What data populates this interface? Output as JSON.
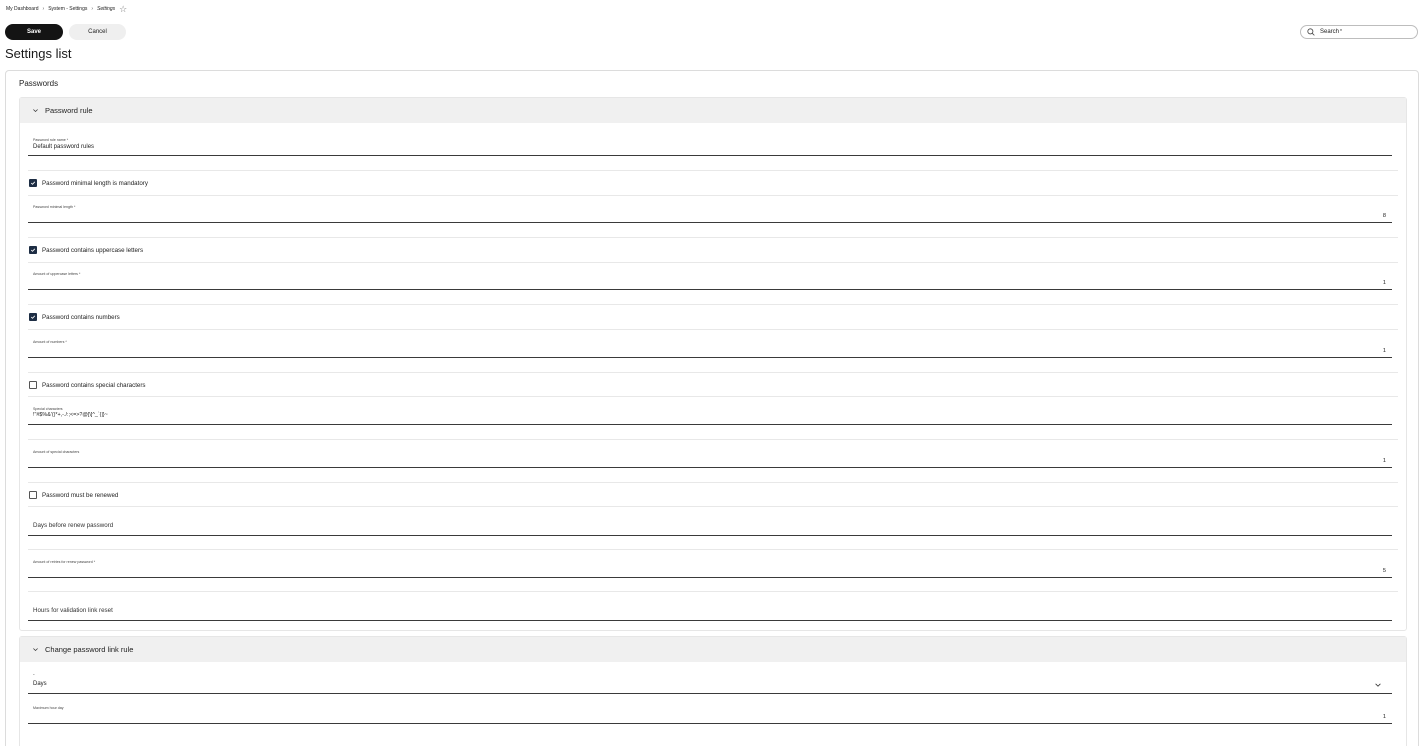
{
  "breadcrumb": {
    "items": [
      "My Dashboard",
      "System - Settings"
    ],
    "current": "Settings",
    "separator": "›"
  },
  "toolbar": {
    "save_label": "Save",
    "cancel_label": "Cancel"
  },
  "search": {
    "placeholder": "Search",
    "required_marker": "*"
  },
  "page": {
    "title": "Settings list"
  },
  "card": {
    "title": "Passwords"
  },
  "password_rule": {
    "header": "Password rule",
    "rule_name": {
      "label": "Password rule name *",
      "value": "Default password rules"
    },
    "min_length_mandatory": {
      "label": "Password minimal length is mandatory",
      "checked": true
    },
    "min_length": {
      "label": "Password minimal length *",
      "value": "8"
    },
    "uppercase": {
      "label": "Password contains uppercase letters",
      "checked": true
    },
    "uppercase_amount": {
      "label": "Amount of uppercase letters *",
      "value": "1"
    },
    "numbers": {
      "label": "Password contains numbers",
      "checked": true
    },
    "numbers_amount": {
      "label": "Amount of numbers *",
      "value": "1"
    },
    "special": {
      "label": "Password contains special characters",
      "checked": false
    },
    "special_chars": {
      "label": "Special characters",
      "value": "!\"#$%&'()*+,-./:;<=>?@[\\]^_`{|}~"
    },
    "special_amount": {
      "label": "Amount of special characters",
      "value": "1"
    },
    "renew": {
      "label": "Password must be renewed",
      "checked": false
    },
    "days_before_renew": {
      "placeholder": "Days before renew password"
    },
    "retries_renew": {
      "label": "Amount of retries for renew password *",
      "value": "5"
    },
    "hours_validation": {
      "placeholder": "Hours for validation link reset"
    }
  },
  "change_link_rule": {
    "header": "Change password link rule",
    "unit": {
      "label": "-",
      "value": "Days"
    },
    "max_hour_day": {
      "label": "Maximum hour day",
      "value": "1"
    }
  },
  "colors": {
    "primary_button": "#141414",
    "checkbox_checked": "#1d2d44",
    "panel_header_bg": "#f0f0f0"
  },
  "icons": {
    "search": "search-icon",
    "star": "star-icon",
    "chevron": "chevron-down-icon",
    "check": "check-icon"
  }
}
